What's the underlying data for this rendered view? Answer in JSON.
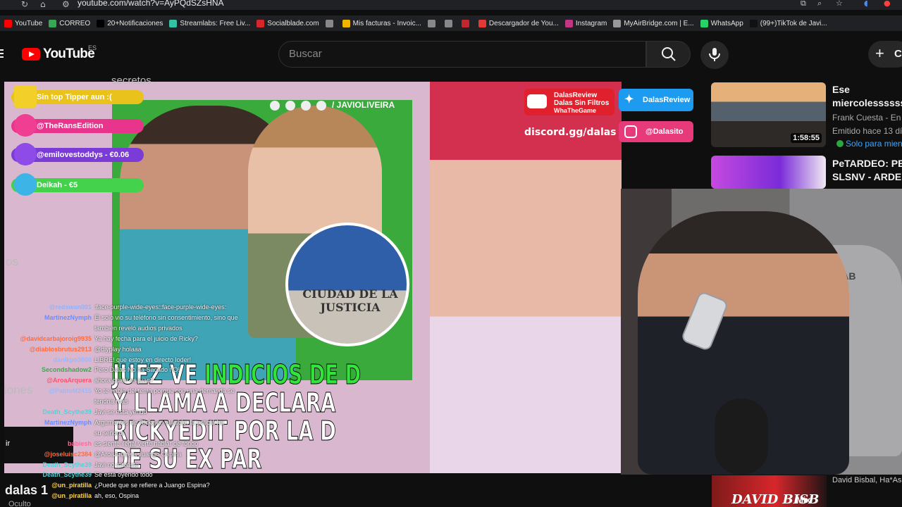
{
  "browser": {
    "url": "youtube.com/watch?v=AyPQdSZsHNA",
    "bookmarks": [
      {
        "label": "YouTube",
        "color": "#ff0000"
      },
      {
        "label": "CORREO",
        "color": "#34a853"
      },
      {
        "label": "20+Notificaciones",
        "color": "#000000"
      },
      {
        "label": "Streamlabs: Free Liv...",
        "color": "#31c3a2"
      },
      {
        "label": "Socialblade.com",
        "color": "#d8262b"
      },
      {
        "label": "",
        "color": "#888888"
      },
      {
        "label": "Mis facturas - Invoic...",
        "color": "#f0b400"
      },
      {
        "label": "",
        "color": "#888888"
      },
      {
        "label": "",
        "color": "#888888"
      },
      {
        "label": "",
        "color": "#c4262e"
      },
      {
        "label": "Descargador de You...",
        "color": "#e53935"
      },
      {
        "label": "Instagram",
        "color": "#c13584"
      },
      {
        "label": "MyAirBridge.com | E...",
        "color": "#999999"
      },
      {
        "label": "WhatsApp",
        "color": "#25d366"
      },
      {
        "label": "(99+)TikTok de Javi...",
        "color": "#111111"
      }
    ]
  },
  "header": {
    "logo_text": "YouTube",
    "country_code": "ES",
    "search_placeholder": "Buscar",
    "create_label": "C"
  },
  "video": {
    "behind_text_top": "secretos .",
    "behind_text_left1": "os",
    "behind_text_left2": "iones",
    "behind_text_left3": "ir",
    "social_handle": "/ JAVIOLIVEIRA",
    "circle_caption": "CIUDAD DE LA JUSTICIA",
    "headline_line1_a": "JUEZ VE ",
    "headline_line1_b": "INDICIOS DE D",
    "headline_line2": "Y LLAMA A DECLARA",
    "headline_line3": "RICKYEDIT POR LA D",
    "headline_line4": "DE SU EX PAR",
    "discord": "discord.gg/dalas",
    "tip_badges": [
      "Sin top Tipper aun :(",
      "@TheRansEdition",
      "@emilovestoddys - €0.06",
      "Deikah - €5"
    ],
    "social_badges": {
      "youtube_l1": "DalasReview",
      "youtube_l2": "Dalas Sin Filtros",
      "youtube_l3": "WhaTheGame",
      "twitter": "DalasReview",
      "instagram": "@Dalasito"
    }
  },
  "chat": [
    {
      "user": "@redswan001",
      "color": "#8fb3ff",
      "msg": ":face-purple-wide-eyes::face-purple-wide-eyes:"
    },
    {
      "user": "MartinezNymph",
      "color": "#6b8cff",
      "msg": "Él solo vio su teléfono sin consentimiento, sino que"
    },
    {
      "user": "",
      "color": "#ffffff",
      "msg": "también reveló audios privados"
    },
    {
      "user": "@davidcarbajoroig9935",
      "color": "#ff6b3d",
      "msg": "Ya hay fecha para el juicio de Ricky?"
    },
    {
      "user": "@diablosbrutus2913",
      "color": "#ff6b3d",
      "msg": "@diyplay holaaa"
    },
    {
      "user": "danlkpo3000",
      "color": "#9ab7ff",
      "msg": "LIBRE! que estoy en directo loder!"
    },
    {
      "user": "Secondshadow2",
      "color": "#3ea84d",
      "msg": "Pero Dalas No ha Sacado nO!"
    },
    {
      "user": "@AroaArquera",
      "color": "#ff4f6b",
      "msg": "ahora quien es juan?"
    },
    {
      "user": "@PabloM2415",
      "color": "#9ab7ff",
      "msg": "Yo te habla del tema porque con una demanda se"
    },
    {
      "user": "",
      "color": "#ffffff",
      "msg": "tendría más"
    },
    {
      "user": "Death_Scythe39",
      "color": "#4fd3d8",
      "msg": "Javi se está yendo"
    },
    {
      "user": "MartinezNymph",
      "color": "#6b8cff",
      "msg": "Argumentos de Ricky en el juicio: la policía ha"
    },
    {
      "user": "",
      "color": "#ffffff",
      "msg": "su señoría"
    },
    {
      "user": "babiesh",
      "color": "#ff6b9a",
      "msg": "es siente ilegal verte hablar de fondo"
    },
    {
      "user": "@joseluisc2384",
      "color": "#ff6b3d",
      "msg": "@AroaArquera Juango Ospina"
    },
    {
      "user": "Death_Scythe39",
      "color": "#4fd3d8",
      "msg": "Javi no mteaste"
    },
    {
      "user": "Death_Scythe39",
      "color": "#4fd3d8",
      "msg": "Se está oyendo todo"
    },
    {
      "user": "@un_piratilla",
      "color": "#ffd54f",
      "msg": "¿Puede que se refiere a Juango Espina?"
    },
    {
      "user": "@un_piratilla",
      "color": "#ffd54f",
      "msg": "ah, eso, Ospina"
    }
  ],
  "webcam": {
    "chair_brand": "SECRET LAB"
  },
  "sidebar": [
    {
      "title_1": "Ese",
      "title_2": "miercolessssssss",
      "meta_1": "Frank Cuesta - En D",
      "meta_2": "Emitido hace 13 día",
      "duration": "1:58:55",
      "members": "Solo para mien"
    },
    {
      "title_1": "PeTARDEO: PEP",
      "title_2": "SLSNV - ARDE T"
    }
  ],
  "bottom": {
    "channel_name": "dalas 1",
    "hidden_label": "Oculto",
    "mix_thumb_text": "DAVID BISB",
    "mix_label": "Mix",
    "mix_title": "David Bisbal, Ha*As"
  }
}
